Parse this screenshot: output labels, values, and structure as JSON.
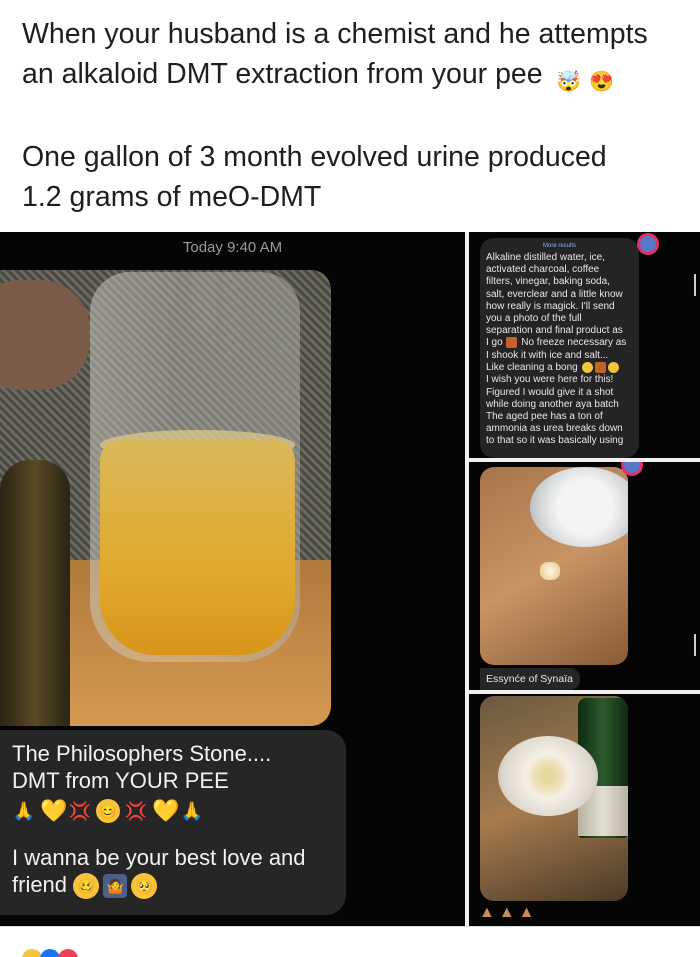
{
  "post": {
    "line1": "When your husband is a chemist and he attempts",
    "line2": "an alkaloid DMT extraction from your pee",
    "emoji1": "🤯",
    "emoji2": "😍",
    "line3": "One gallon of 3 month evolved urine produced",
    "line4": "1.2 grams of meO-DMT"
  },
  "left_panel": {
    "timestamp": "Today 9:40 AM",
    "bubble_line1": "The Philosophers Stone....",
    "bubble_line2": "DMT from YOUR PEE",
    "emoji_row": [
      "🙏",
      "💛",
      "💢",
      "😊",
      "💢",
      "💛",
      "🙏"
    ],
    "bubble_line3": "I wanna be your best love and",
    "bubble_line4": "friend",
    "bubble_line4_emojis": [
      "🥴",
      "🤷",
      "🥺"
    ]
  },
  "right_top": {
    "more_results": "More results",
    "lines": [
      "Alkaline distilled water, ice,",
      "activated charcoal, coffee",
      "filters, vinegar, baking soda,",
      "salt, everclear and a little know",
      "how really is magick. I'll send",
      "you a photo of the full",
      "separation and final product as",
      "I go",
      "No freeze necessary as",
      "I shook it with ice and salt...",
      "Like cleaning a bong",
      "I wish you were here for this!",
      "Figured I would give it a shot",
      "while doing another aya batch",
      "The aged pee has a ton of",
      "ammonia as urea breaks down",
      "to that so it was basically using"
    ]
  },
  "right_mid": {
    "caption": "Essynće of Synaïa"
  },
  "colors": {
    "bubble_dark": "#262626",
    "accent_blue": "#5b78c8",
    "reaction_ring": "#e1306c"
  }
}
